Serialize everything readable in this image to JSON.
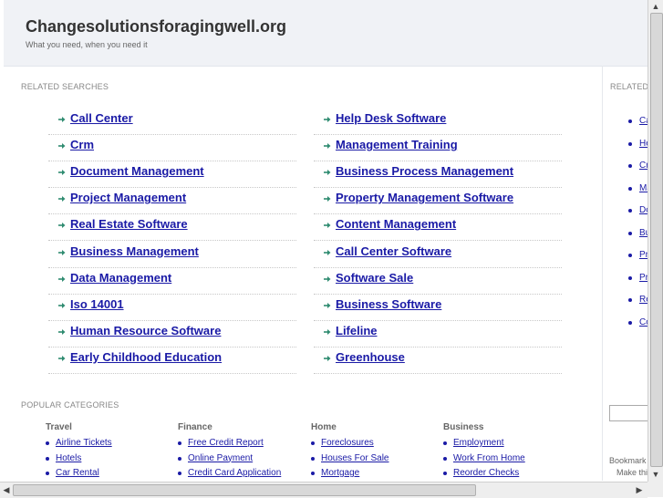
{
  "header": {
    "site_title": "Changesolutionsforagingwell.org",
    "tagline": "What you need, when you need it"
  },
  "related_searches": {
    "heading": "RELATED SEARCHES",
    "left_column": [
      "Call Center",
      "Crm",
      "Document Management",
      "Project Management",
      "Real Estate Software",
      "Business Management",
      "Data Management",
      "Iso 14001",
      "Human Resource Software",
      "Early Childhood Education"
    ],
    "right_column": [
      "Help Desk Software",
      "Management Training",
      "Business Process Management",
      "Property Management Software",
      "Content Management",
      "Call Center Software",
      "Software Sale",
      "Business Software",
      "Lifeline",
      "Greenhouse"
    ]
  },
  "popular_categories": {
    "heading": "POPULAR CATEGORIES",
    "categories": [
      {
        "title": "Travel",
        "links": [
          "Airline Tickets",
          "Hotels",
          "Car Rental"
        ]
      },
      {
        "title": "Finance",
        "links": [
          "Free Credit Report",
          "Online Payment",
          "Credit Card Application"
        ]
      },
      {
        "title": "Home",
        "links": [
          "Foreclosures",
          "Houses For Sale",
          "Mortgage"
        ]
      },
      {
        "title": "Business",
        "links": [
          "Employment",
          "Work From Home",
          "Reorder Checks"
        ]
      }
    ]
  },
  "sidebar": {
    "heading": "RELATED",
    "links": [
      "Ca",
      "He",
      "Cr",
      "Ma",
      "Do",
      "Bu",
      "Pr",
      "Pr",
      "Re",
      "Co"
    ],
    "bookmark_text": "Bookmark",
    "make_text": "Make thi"
  },
  "colors": {
    "link": "#1a1aa6",
    "arrow": "#2e8b70",
    "header_bg": "#f0f2f6"
  },
  "icons": {
    "list_arrow": "arrow-right-icon",
    "bullet": "bullet-icon"
  }
}
